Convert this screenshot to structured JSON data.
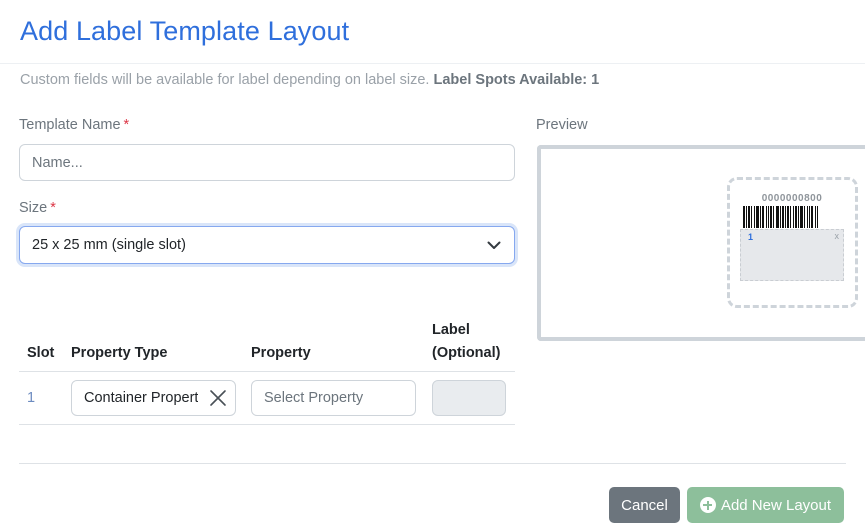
{
  "header": {
    "title": "Add Label Template Layout"
  },
  "info": {
    "text": "Custom fields will be available for label depending on label size.",
    "strong": "Label Spots Available: 1"
  },
  "form": {
    "template_name": {
      "label": "Template Name",
      "required_mark": "*",
      "placeholder": "Name..."
    },
    "size": {
      "label": "Size",
      "required_mark": "*",
      "selected": "25 x 25 mm (single slot)"
    }
  },
  "slots_table": {
    "headers": {
      "slot": "Slot",
      "property_type": "Property Type",
      "property": "Property",
      "label_line1": "Label",
      "label_line2": "(Optional)"
    },
    "rows": [
      {
        "slot": "1",
        "property_type": "Container Propert",
        "property_placeholder": "Select Property",
        "label_value": ""
      }
    ]
  },
  "preview": {
    "label": "Preview",
    "barcode_number": "0000000800",
    "slot_number": "1",
    "slot_remove": "x"
  },
  "footer": {
    "cancel": "Cancel",
    "add": "Add New Layout"
  },
  "colors": {
    "accent": "#2f6fdc",
    "required": "#dc3545",
    "cancel": "#6c757d",
    "add": "#8dbf9b"
  },
  "icons": {
    "clear": "close-icon",
    "dropdown": "chevron-down-icon",
    "add": "plus-circle-icon"
  }
}
